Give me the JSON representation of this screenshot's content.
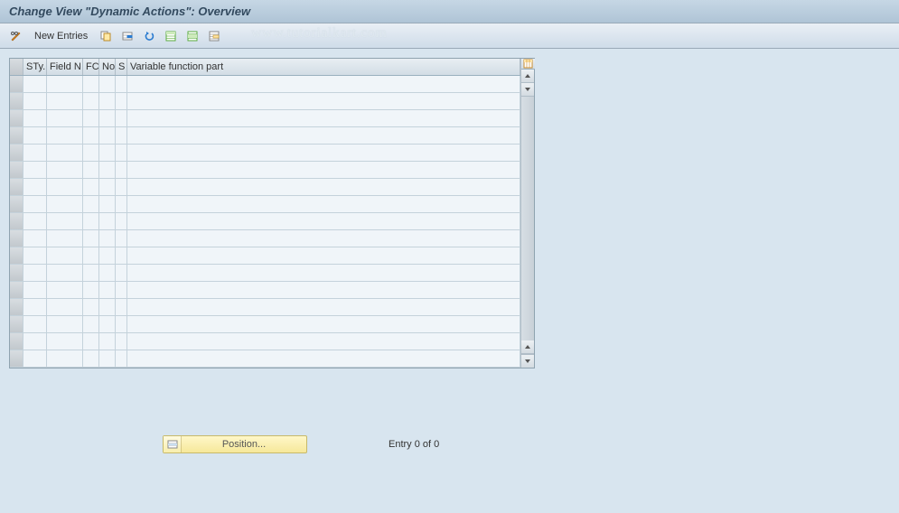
{
  "title": "Change View \"Dynamic Actions\": Overview",
  "toolbar": {
    "new_entries_label": "New Entries"
  },
  "watermark": "www.tutorialkart.com",
  "grid": {
    "headers": {
      "sty": "STy.",
      "field_n": "Field N",
      "fc": "FC",
      "no": "No",
      "s": "S",
      "variable_part": "Variable function part"
    },
    "row_count": 17
  },
  "footer": {
    "position_label": "Position...",
    "entry_status": "Entry 0 of 0"
  }
}
